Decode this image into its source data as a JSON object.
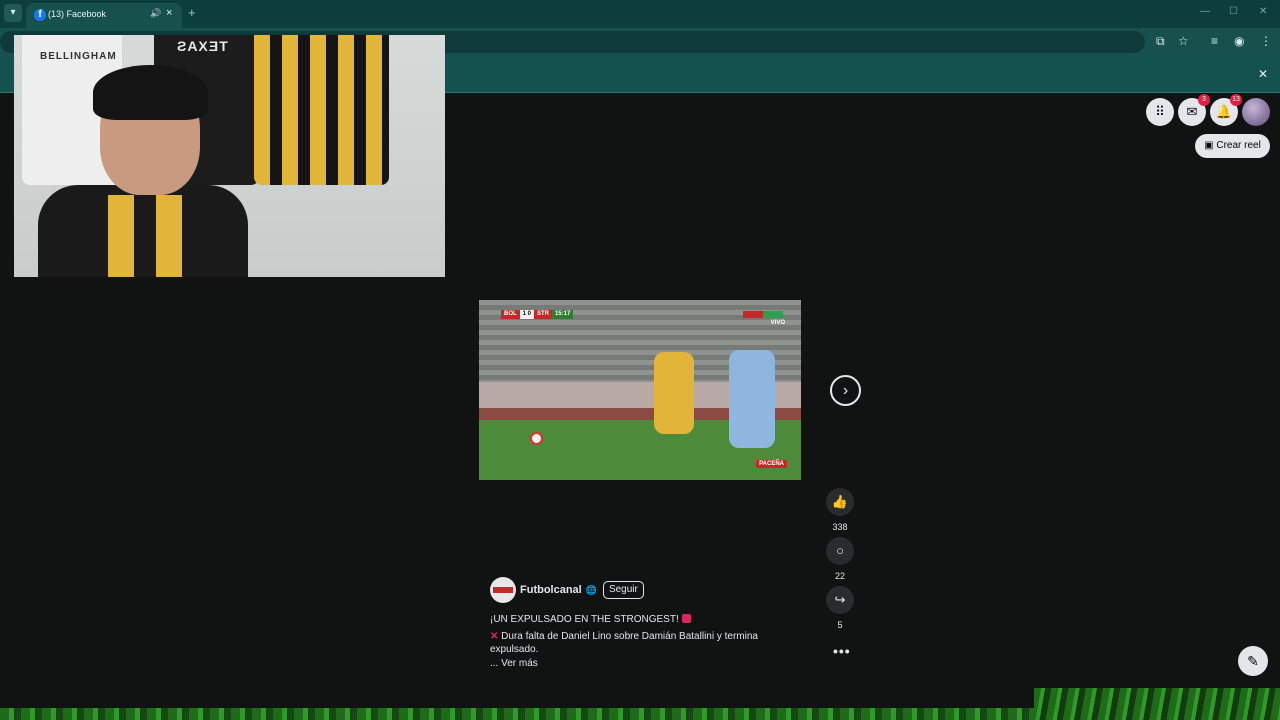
{
  "browser": {
    "tab_title": "(13) Facebook",
    "tab_icon": "facebook-favicon",
    "new_tab_symbol": "+",
    "minimize_symbol": "—",
    "maximize_symbol": "☐",
    "close_symbol": "✕",
    "accent": "#0d3e3c"
  },
  "facebook": {
    "menu_icon": "grid-icon",
    "messenger_badge": "3",
    "notifications_badge": "13",
    "create_reel_label": "Crear reel"
  },
  "video": {
    "home_abbr": "BOL",
    "score": "1 0",
    "away_abbr": "STR",
    "clock": "15:17",
    "live_label": "VIVO",
    "brand_label": "PACEÑA"
  },
  "reel": {
    "author": "Futbolcanal",
    "follow_label": "Seguir",
    "caption_line1": "¡UN EXPULSADO EN THE STRONGEST!",
    "caption_line2": "Dura falta de Daniel Lino sobre Damián Batallini y termina expulsado.",
    "see_more": "... Ver más",
    "likes": "338",
    "comments": "22",
    "shares": "5"
  },
  "webcam": {
    "jersey_text_1": "BELLINGHAM",
    "jersey_text_2": "TEXAS"
  }
}
